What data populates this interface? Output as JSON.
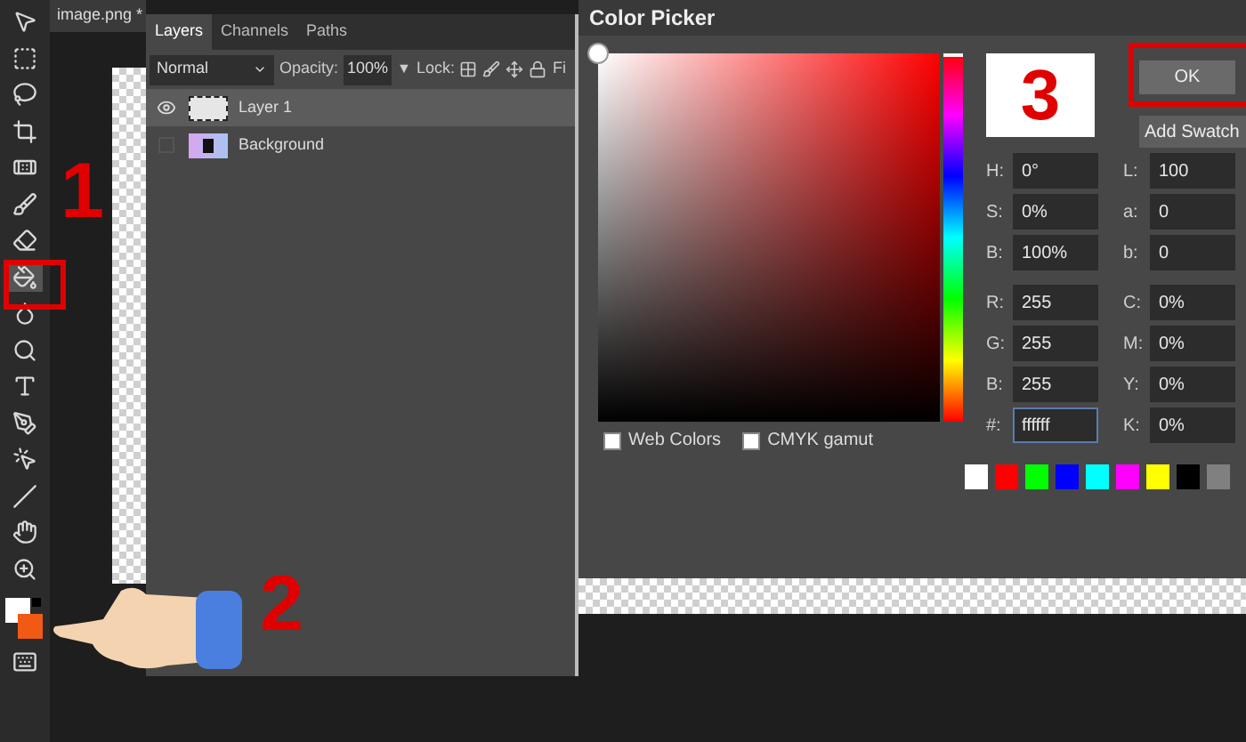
{
  "document_tab": {
    "title": "image.png *"
  },
  "layers_panel": {
    "tabs": [
      {
        "label": "Layers",
        "selected": true
      },
      {
        "label": "Channels",
        "selected": false
      },
      {
        "label": "Paths",
        "selected": false
      }
    ],
    "blend_mode": "Normal",
    "opacity_label": "Opacity:",
    "opacity_value": "100%",
    "opacity_arrow": "▼",
    "lock_label": "Lock:",
    "fill_label": "Fi",
    "layers": [
      {
        "name": "Layer 1",
        "selected": true,
        "visible": true,
        "kind": "blank"
      },
      {
        "name": "Background",
        "selected": false,
        "visible": false,
        "kind": "image"
      }
    ]
  },
  "color_picker": {
    "title": "Color Picker",
    "hue_slider": {
      "level": 0
    },
    "buttons": [
      {
        "label": "OK",
        "kind": "primary"
      },
      {
        "label": "Add Swatch",
        "kind": "secondary"
      }
    ],
    "field_groups": [
      {
        "left_fields": [
          {
            "label": "H:",
            "value": "0°"
          },
          {
            "label": "S:",
            "value": "0%"
          },
          {
            "label": "B:",
            "value": "100%"
          }
        ],
        "right_fields": [
          {
            "label": "L:",
            "value": "100"
          },
          {
            "label": "a:",
            "value": "0"
          },
          {
            "label": "b:",
            "value": "0"
          }
        ]
      },
      {
        "left_fields": [
          {
            "label": "R:",
            "value": "255"
          },
          {
            "label": "G:",
            "value": "255"
          },
          {
            "label": "B:",
            "value": "255"
          },
          {
            "label": "#:",
            "value": "ffffff",
            "focused": true
          }
        ],
        "right_fields": [
          {
            "label": "C:",
            "value": "0%"
          },
          {
            "label": "M:",
            "value": "0%"
          },
          {
            "label": "Y:",
            "value": "0%"
          },
          {
            "label": "K:",
            "value": "0%"
          }
        ]
      }
    ],
    "checkboxes": [
      {
        "label": "Web Colors",
        "checked": false
      },
      {
        "label": "CMYK gamut",
        "checked": false
      }
    ],
    "swatches": [
      {
        "color": "#ffffff"
      },
      {
        "color": "#ff0000"
      },
      {
        "color": "#00ff00"
      },
      {
        "color": "#0000ff"
      },
      {
        "color": "#00ffff"
      },
      {
        "color": "#ff00ff"
      },
      {
        "color": "#ffff00"
      },
      {
        "color": "#000000"
      },
      {
        "color": "#808080"
      }
    ]
  },
  "annotations": [
    {
      "label": "1"
    },
    {
      "label": "2"
    },
    {
      "label": "3"
    }
  ]
}
